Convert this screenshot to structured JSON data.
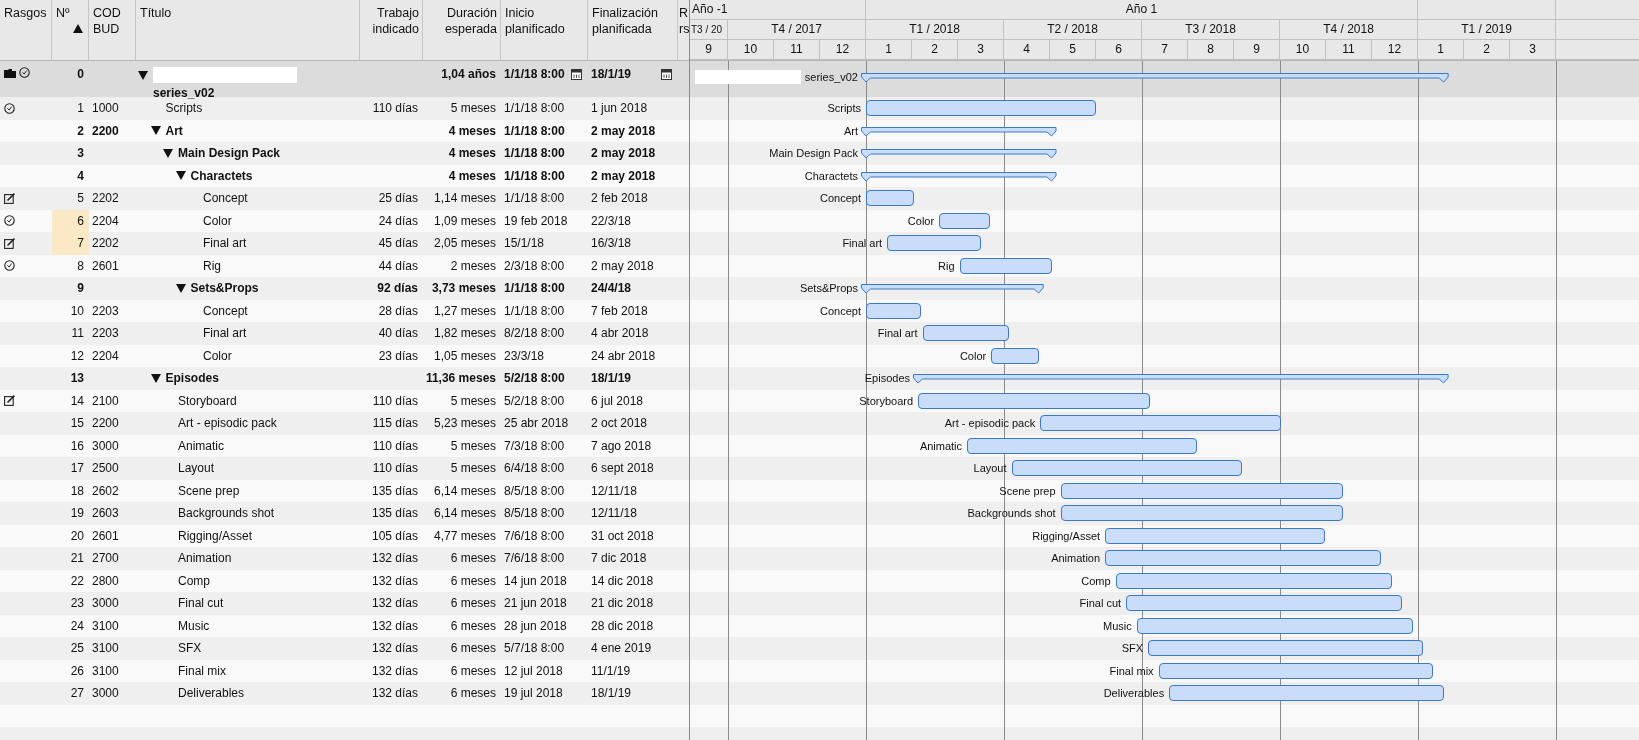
{
  "columns": [
    {
      "label": "Rasgos"
    },
    {
      "label": "Nº",
      "sort_ascending": true
    },
    {
      "label": "COD\nBUD"
    },
    {
      "label": "Título"
    },
    {
      "label": "Trabajo\nindicado"
    },
    {
      "label": "Duración\nesperada"
    },
    {
      "label": "Inicio\nplanificado"
    },
    {
      "label": "Finalización\nplanificada"
    },
    {
      "label": "R\nrs"
    }
  ],
  "rows": [
    {
      "kind": "summary",
      "expanded": true,
      "num": "0",
      "title": "series_v02",
      "redacted": true,
      "traits": [
        {
          "kind": "folder"
        },
        {
          "kind": "clock"
        }
      ],
      "duration": "1,04 años",
      "start": "1/1/18 8:00",
      "finish": "18/1/19",
      "date_constraint": true,
      "children": [
        {
          "kind": "task",
          "num": "1",
          "code": "1000",
          "title": "Scripts",
          "traits": [
            {
              "kind": "clock"
            }
          ],
          "work": "110 días",
          "duration": "5 meses",
          "start": "1/1/18 8:00",
          "finish": "1 jun 2018"
        },
        {
          "kind": "summary",
          "expanded": true,
          "num": "2",
          "code": "2200",
          "title": "Art",
          "duration": "4 meses",
          "start": "1/1/18 8:00",
          "finish": "2 may 2018",
          "children": [
            {
              "kind": "summary",
              "expanded": true,
              "num": "3",
              "title": "Main Design Pack",
              "duration": "4 meses",
              "start": "1/1/18 8:00",
              "finish": "2 may 2018",
              "children": [
                {
                  "kind": "summary",
                  "expanded": true,
                  "num": "4",
                  "title": "Charactets",
                  "duration": "4 meses",
                  "start": "1/1/18 8:00",
                  "finish": "2 may 2018",
                  "children": [
                    {
                      "kind": "task",
                      "num": "5",
                      "code": "2202",
                      "title": "Concept",
                      "traits": [
                        {
                          "kind": "note"
                        }
                      ],
                      "work": "25 días",
                      "duration": "1,14 meses",
                      "start": "1/1/18 8:00",
                      "finish": "2 feb 2018"
                    },
                    {
                      "kind": "task",
                      "num": "6",
                      "code": "2204",
                      "title": "Color",
                      "traits": [
                        {
                          "kind": "clock"
                        }
                      ],
                      "flagged": true,
                      "work": "24 días",
                      "duration": "1,09 meses",
                      "start": "19 feb 2018",
                      "finish": "22/3/18"
                    },
                    {
                      "kind": "task",
                      "num": "7",
                      "code": "2202",
                      "title": "Final art",
                      "traits": [
                        {
                          "kind": "note"
                        }
                      ],
                      "flagged": true,
                      "work": "45 días",
                      "duration": "2,05 meses",
                      "start": "15/1/18",
                      "finish": "16/3/18"
                    },
                    {
                      "kind": "task",
                      "num": "8",
                      "code": "2601",
                      "title": "Rig",
                      "traits": [
                        {
                          "kind": "clock"
                        }
                      ],
                      "work": "44 días",
                      "duration": "2 meses",
                      "start": "2/3/18 8:00",
                      "finish": "2 may 2018"
                    }
                  ]
                },
                {
                  "kind": "summary",
                  "expanded": true,
                  "num": "9",
                  "title": "Sets&Props",
                  "work": "92 días",
                  "duration": "3,73 meses",
                  "start": "1/1/18 8:00",
                  "finish": "24/4/18",
                  "children": [
                    {
                      "kind": "task",
                      "num": "10",
                      "code": "2203",
                      "title": "Concept",
                      "work": "28 días",
                      "duration": "1,27 meses",
                      "start": "1/1/18 8:00",
                      "finish": "7 feb 2018"
                    },
                    {
                      "kind": "task",
                      "num": "11",
                      "code": "2203",
                      "title": "Final art",
                      "work": "40 días",
                      "duration": "1,82 meses",
                      "start": "8/2/18 8:00",
                      "finish": "4 abr 2018"
                    },
                    {
                      "kind": "task",
                      "num": "12",
                      "code": "2204",
                      "title": "Color",
                      "work": "23 días",
                      "duration": "1,05 meses",
                      "start": "23/3/18",
                      "finish": "24 abr 2018"
                    }
                  ]
                }
              ]
            }
          ]
        },
        {
          "kind": "summary",
          "expanded": true,
          "num": "13",
          "title": "Episodes",
          "duration": "11,36 meses",
          "start": "5/2/18 8:00",
          "finish": "18/1/19",
          "children": [
            {
              "kind": "task",
              "num": "14",
              "code": "2100",
              "title": "Storyboard",
              "traits": [
                {
                  "kind": "note"
                }
              ],
              "work": "110 días",
              "duration": "5 meses",
              "start": "5/2/18 8:00",
              "finish": "6 jul 2018"
            },
            {
              "kind": "task",
              "num": "15",
              "code": "2200",
              "title": "Art - episodic pack",
              "work": "115 días",
              "duration": "5,23 meses",
              "start": "25 abr 2018",
              "finish": "2 oct 2018"
            },
            {
              "kind": "task",
              "num": "16",
              "code": "3000",
              "title": "Animatic",
              "work": "110 días",
              "duration": "5 meses",
              "start": "7/3/18 8:00",
              "finish": "7 ago 2018"
            },
            {
              "kind": "task",
              "num": "17",
              "code": "2500",
              "title": "Layout",
              "work": "110 días",
              "duration": "5 meses",
              "start": "6/4/18 8:00",
              "finish": "6 sept 2018"
            },
            {
              "kind": "task",
              "num": "18",
              "code": "2602",
              "title": "Scene prep",
              "work": "135 días",
              "duration": "6,14 meses",
              "start": "8/5/18 8:00",
              "finish": "12/11/18"
            },
            {
              "kind": "task",
              "num": "19",
              "code": "2603",
              "title": "Backgrounds shot",
              "work": "135 días",
              "duration": "6,14 meses",
              "start": "8/5/18 8:00",
              "finish": "12/11/18"
            },
            {
              "kind": "task",
              "num": "20",
              "code": "2601",
              "title": "Rigging/Asset",
              "work": "105 días",
              "duration": "4,77 meses",
              "start": "7/6/18 8:00",
              "finish": "31 oct 2018"
            },
            {
              "kind": "task",
              "num": "21",
              "code": "2700",
              "title": "Animation",
              "work": "132 días",
              "duration": "6 meses",
              "start": "7/6/18 8:00",
              "finish": "7 dic 2018"
            },
            {
              "kind": "task",
              "num": "22",
              "code": "2800",
              "title": "Comp",
              "work": "132 días",
              "duration": "6 meses",
              "start": "14 jun 2018",
              "finish": "14 dic 2018"
            },
            {
              "kind": "task",
              "num": "23",
              "code": "3000",
              "title": "Final cut",
              "work": "132 días",
              "duration": "6 meses",
              "start": "21 jun 2018",
              "finish": "21 dic 2018"
            },
            {
              "kind": "task",
              "num": "24",
              "code": "3100",
              "title": "Music",
              "work": "132 días",
              "duration": "6 meses",
              "start": "28 jun 2018",
              "finish": "28 dic 2018"
            },
            {
              "kind": "task",
              "num": "25",
              "code": "3100",
              "title": "SFX",
              "work": "132 días",
              "duration": "6 meses",
              "start": "5/7/18 8:00",
              "finish": "4 ene 2019"
            },
            {
              "kind": "task",
              "num": "26",
              "code": "3100",
              "title": "Final mix",
              "work": "132 días",
              "duration": "6 meses",
              "start": "12 jul 2018",
              "finish": "11/1/19"
            },
            {
              "kind": "task",
              "num": "27",
              "code": "3000",
              "title": "Deliverables",
              "work": "132 días",
              "duration": "6 meses",
              "start": "19 jul 2018",
              "finish": "18/1/19"
            }
          ]
        }
      ]
    }
  ],
  "gantt": {
    "years": [
      "Año -1",
      "Año 1"
    ],
    "quarters": [
      "T3 / 20",
      "T4 / 2017",
      "T1 / 2018",
      "T2 / 2018",
      "T3 / 2018",
      "T4 / 2018",
      "T1 / 2019"
    ],
    "months": [
      "9",
      "10",
      "11",
      "12",
      "1",
      "2",
      "3",
      "4",
      "5",
      "6",
      "7",
      "8",
      "9",
      "10",
      "11",
      "12",
      "1",
      "2",
      "3"
    ],
    "bars": [
      {
        "label": "series_v02",
        "redacted": true
      },
      {
        "label": "Scripts"
      },
      {
        "label": "Art"
      },
      {
        "label": "Main Design Pack"
      },
      {
        "label": "Charactets"
      },
      {
        "label": "Concept"
      },
      {
        "label": "Color"
      },
      {
        "label": "Final art"
      },
      {
        "label": "Rig"
      },
      {
        "label": "Sets&Props"
      },
      {
        "label": "Concept"
      },
      {
        "label": "Final art"
      },
      {
        "label": "Color"
      },
      {
        "label": "Episodes"
      },
      {
        "label": "Storyboard"
      },
      {
        "label": "Art - episodic pack"
      },
      {
        "label": "Animatic"
      },
      {
        "label": "Layout"
      },
      {
        "label": "Scene prep"
      },
      {
        "label": "Backgrounds shot"
      },
      {
        "label": "Rigging/Asset"
      },
      {
        "label": "Animation"
      },
      {
        "label": "Comp"
      },
      {
        "label": "Final cut"
      },
      {
        "label": "Music"
      },
      {
        "label": "SFX"
      },
      {
        "label": "Final mix"
      },
      {
        "label": "Deliverables"
      }
    ]
  }
}
